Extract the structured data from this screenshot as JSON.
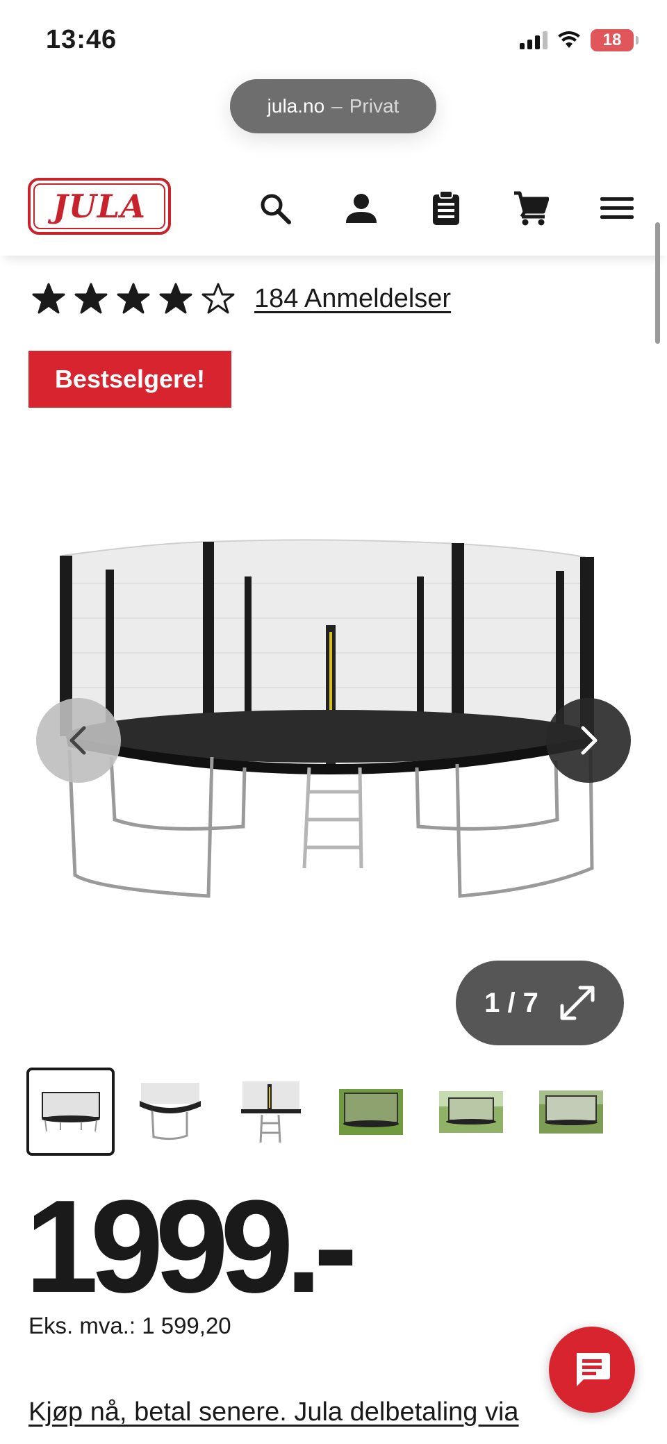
{
  "status_bar": {
    "time": "13:46",
    "battery": "18"
  },
  "browser": {
    "domain": "jula.no",
    "separator": "–",
    "mode": "Privat"
  },
  "header": {
    "logo_text": "JULA",
    "icons": [
      "search-icon",
      "account-icon",
      "clipboard-icon",
      "cart-icon",
      "menu-icon"
    ]
  },
  "product": {
    "rating": 4,
    "rating_max": 5,
    "reviews_label": "184 Anmeldelser",
    "badge": "Bestselgere!",
    "gallery": {
      "counter": "1 / 7",
      "current": 1,
      "total": 7
    },
    "price": "1999.-",
    "ex_vat": "Eks. mva.: 1 599,20",
    "installment_link": "Kjøp nå, betal senere. Jula delbetaling via"
  },
  "colors": {
    "brand_red": "#d8242f",
    "text": "#1a1a1a",
    "pill_grey": "#565656"
  }
}
